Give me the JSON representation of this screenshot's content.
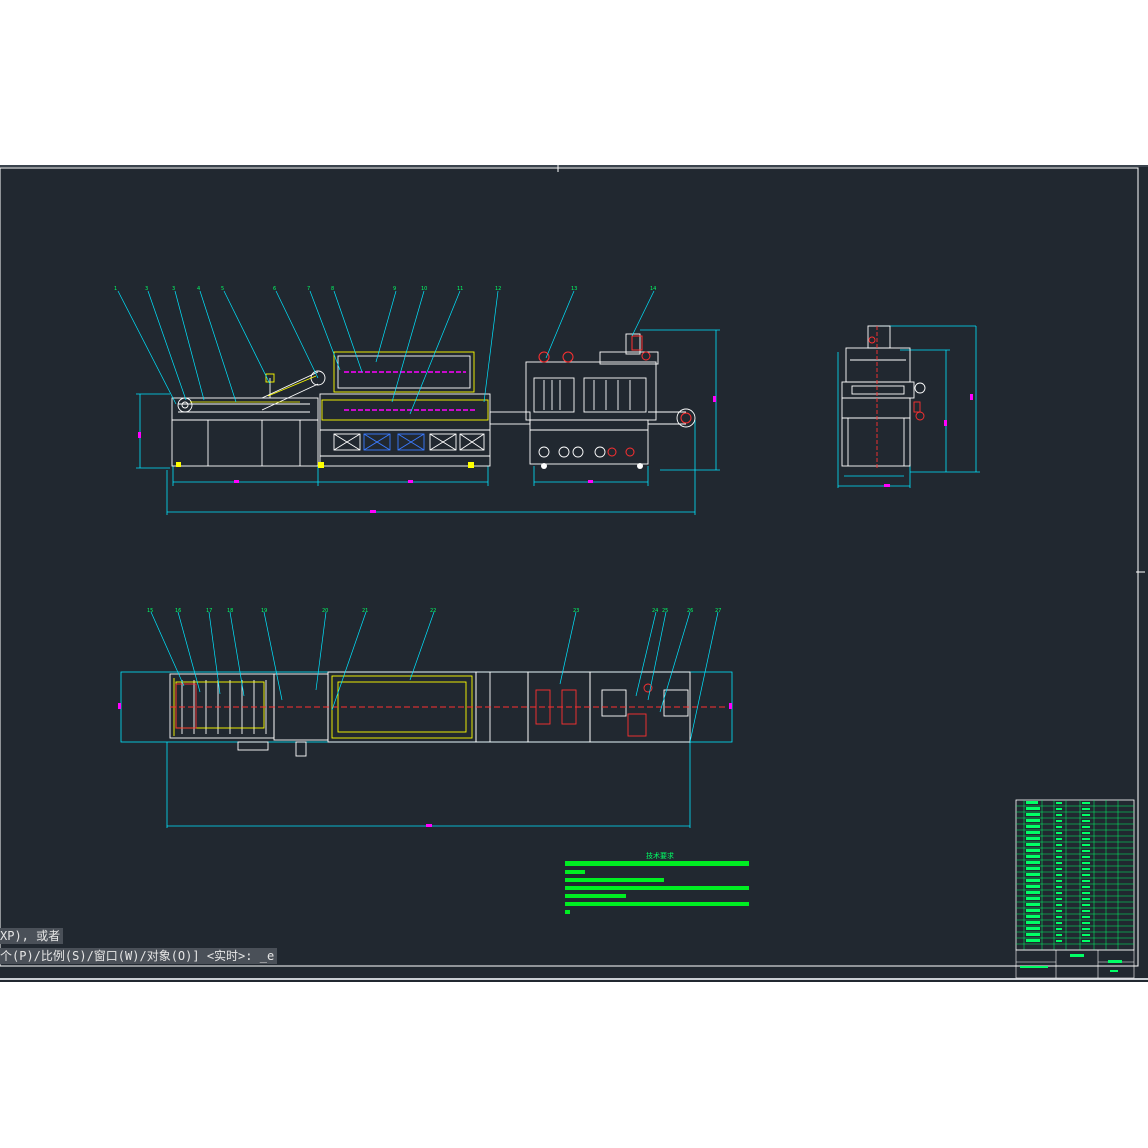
{
  "command_line": {
    "line1": "XP), 或者",
    "line2": "个(P)/比例(S)/窗口(W)/对象(O)] <实时>: _e"
  },
  "drawing": {
    "front_view_labels": [
      "1",
      "3",
      "3",
      "4",
      "5",
      "6",
      "7",
      "8",
      "9",
      "10",
      "11",
      "12",
      "13",
      "14"
    ],
    "top_view_labels": [
      "15",
      "16",
      "17",
      "18",
      "19",
      "20",
      "21",
      "22",
      "23",
      "24",
      "25",
      "26",
      "27"
    ],
    "notes_title": "技术要求",
    "title_block_name": "",
    "colors": {
      "background": "#212830",
      "frame": "#ffffff",
      "leader": "#00e5ff",
      "dimension": "#00e5ff",
      "label": "#00ff66",
      "highlight": "#ffff00",
      "accent_red": "#ff3030",
      "accent_magenta": "#ff00ff",
      "notes_bar": "#00ee22"
    }
  }
}
